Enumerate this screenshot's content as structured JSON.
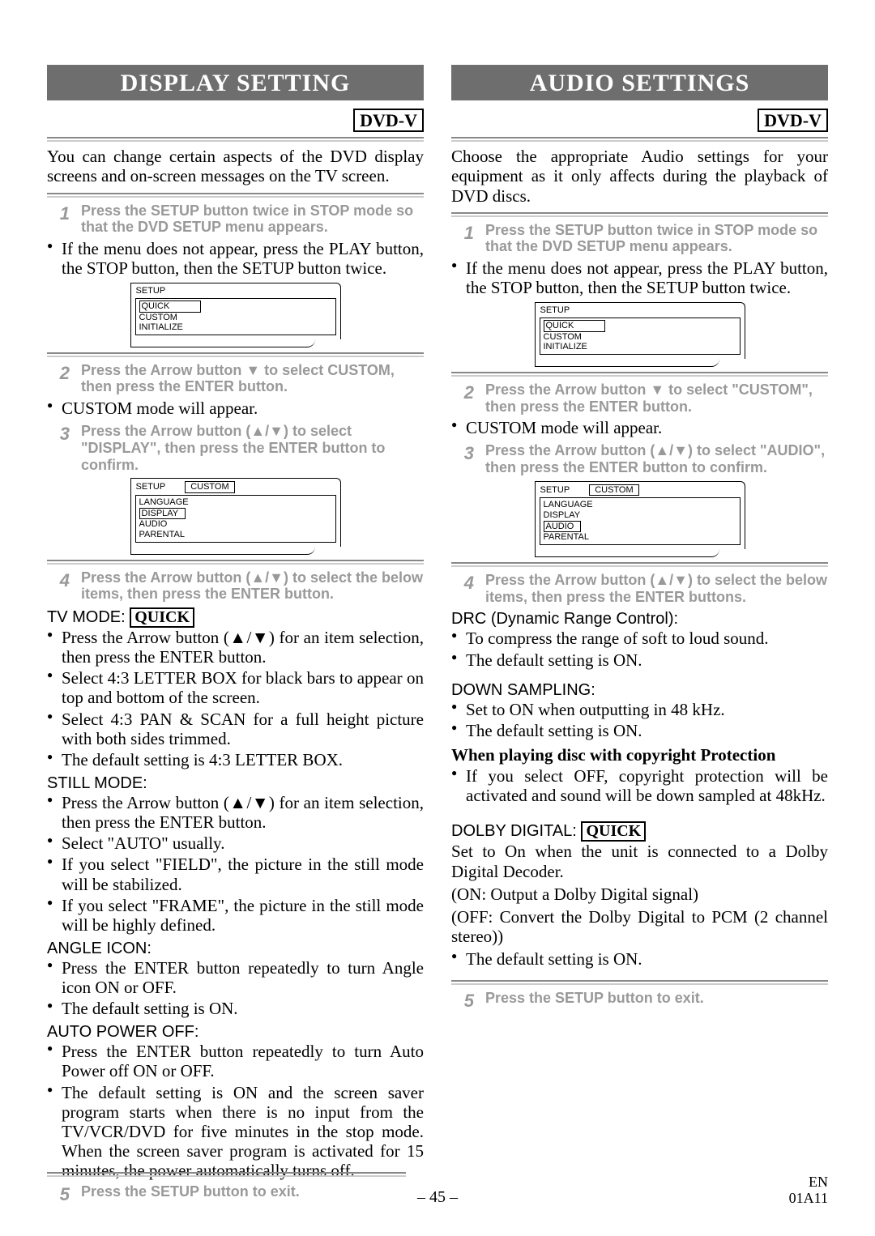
{
  "left": {
    "banner": "DISPLAY SETTING",
    "dvdv": "DVD-V",
    "intro": "You can change certain aspects of the DVD display screens and on-screen messages on the TV screen.",
    "step1": "Press the SETUP button twice in STOP mode so that the DVD SETUP menu appears.",
    "note1": "If the menu does not appear, press the PLAY button, the STOP button, then the SETUP button twice.",
    "osd1_title": "SETUP",
    "osd1_items": [
      "QUICK",
      "CUSTOM",
      "INITIALIZE"
    ],
    "step2": "Press the Arrow button ▼ to select CUSTOM, then press the ENTER button.",
    "note2": "CUSTOM mode will appear.",
    "step3": "Press the Arrow button (▲/▼) to select \"DISPLAY\", then press the ENTER button to confirm.",
    "osd2_title": "SETUP",
    "osd2_tab": "CUSTOM",
    "osd2_items": [
      "LANGUAGE",
      "DISPLAY",
      "AUDIO",
      "PARENTAL"
    ],
    "step4": "Press the Arrow button (▲/▼) to select the below items, then press the ENTER button.",
    "tvmode_head": "TV MODE:",
    "quick": "QUICK",
    "tvmode_bullets": [
      "Press the Arrow button (▲/▼) for an item selection, then press the ENTER button.",
      "Select 4:3 LETTER BOX for black bars to appear on top and bottom of the screen.",
      "Select 4:3 PAN & SCAN for a full height picture with both sides trimmed.",
      "The default setting is 4:3 LETTER BOX."
    ],
    "still_head": "STILL MODE:",
    "still_bullets": [
      "Press the Arrow button (▲/▼) for an item selection, then press the ENTER button.",
      "Select \"AUTO\" usually.",
      "If you select \"FIELD\", the picture in the still mode will be stabilized.",
      "If you select \"FRAME\", the picture in the still mode will be highly defined."
    ],
    "angle_head": "ANGLE ICON:",
    "angle_bullets": [
      "Press the ENTER button repeatedly to turn Angle icon ON or OFF.",
      "The default setting is ON."
    ],
    "auto_head": "AUTO POWER OFF:",
    "auto_bullets": [
      "Press the ENTER button repeatedly to turn Auto Power off ON or OFF.",
      "The default setting is ON and the screen saver program starts when there is no input from the TV/VCR/DVD for five minutes in the stop mode. When the screen saver program is activated for 15 minutes, the power automatically turns off."
    ],
    "step5": "Press the SETUP button to exit."
  },
  "right": {
    "banner": "AUDIO SETTINGS",
    "dvdv": "DVD-V",
    "intro": "Choose the appropriate Audio settings for your equipment as it only affects during the playback of DVD discs.",
    "step1": "Press the SETUP button twice in STOP mode so that the DVD SETUP menu appears.",
    "note1": "If the menu does not appear, press the PLAY button, the STOP button, then the SETUP button twice.",
    "osd1_title": "SETUP",
    "osd1_items": [
      "QUICK",
      "CUSTOM",
      "INITIALIZE"
    ],
    "step2": "Press the Arrow button ▼ to select \"CUSTOM\", then press the ENTER button.",
    "note2": "CUSTOM mode will appear.",
    "step3": "Press the Arrow button (▲/▼) to select \"AUDIO\", then press the ENTER button to confirm.",
    "osd2_title": "SETUP",
    "osd2_tab": "CUSTOM",
    "osd2_items": [
      "LANGUAGE",
      "DISPLAY",
      "AUDIO",
      "PARENTAL"
    ],
    "step4": "Press the Arrow button (▲/▼) to select the below items, then press the ENTER buttons.",
    "drc_head": "DRC (Dynamic Range Control):",
    "drc_bullets": [
      "To compress the range of soft to loud sound.",
      "The default setting is ON."
    ],
    "ds_head": "DOWN SAMPLING:",
    "ds_bullets": [
      "Set to ON when outputting in 48 kHz.",
      "The default setting is ON."
    ],
    "ds_boldline": "When playing disc with copyright Protection",
    "ds_bullets2": [
      "If you select OFF, copyright protection will be activated and sound will be down sampled at 48kHz."
    ],
    "dolby_head": "DOLBY DIGITAL:",
    "dolby_intro": "Set to On when the unit is connected to a Dolby Digital Decoder.",
    "dolby_on": "(ON: Output a Dolby Digital signal)",
    "dolby_off": "(OFF: Convert the Dolby Digital to PCM (2 channel stereo))",
    "dolby_bullets": [
      "The default setting is ON."
    ],
    "step5": "Press the SETUP button to exit."
  },
  "footer": {
    "page": "– 45 –",
    "en": "EN",
    "code": "01A11"
  }
}
